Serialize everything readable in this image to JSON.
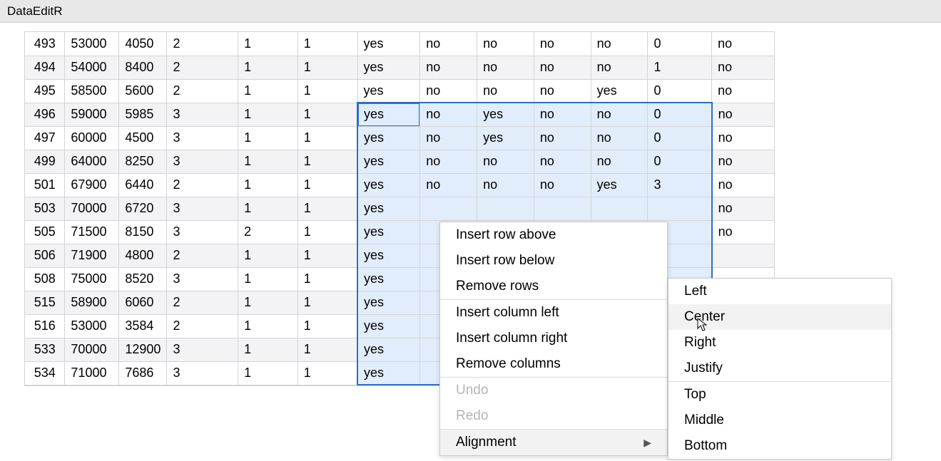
{
  "app": {
    "title": "DataEditR"
  },
  "rows": [
    {
      "idx": "493",
      "c": [
        "53000",
        "4050",
        "2",
        "1",
        "1",
        "yes",
        "no",
        "no",
        "no",
        "no",
        "0",
        "no"
      ]
    },
    {
      "idx": "494",
      "c": [
        "54000",
        "8400",
        "2",
        "1",
        "1",
        "yes",
        "no",
        "no",
        "no",
        "no",
        "1",
        "no"
      ]
    },
    {
      "idx": "495",
      "c": [
        "58500",
        "5600",
        "2",
        "1",
        "1",
        "yes",
        "no",
        "no",
        "no",
        "yes",
        "0",
        "no"
      ]
    },
    {
      "idx": "496",
      "c": [
        "59000",
        "5985",
        "3",
        "1",
        "1",
        "yes",
        "no",
        "yes",
        "no",
        "no",
        "0",
        "no"
      ]
    },
    {
      "idx": "497",
      "c": [
        "60000",
        "4500",
        "3",
        "1",
        "1",
        "yes",
        "no",
        "yes",
        "no",
        "no",
        "0",
        "no"
      ]
    },
    {
      "idx": "499",
      "c": [
        "64000",
        "8250",
        "3",
        "1",
        "1",
        "yes",
        "no",
        "no",
        "no",
        "no",
        "0",
        "no"
      ]
    },
    {
      "idx": "501",
      "c": [
        "67900",
        "6440",
        "2",
        "1",
        "1",
        "yes",
        "no",
        "no",
        "no",
        "yes",
        "3",
        "no"
      ]
    },
    {
      "idx": "503",
      "c": [
        "70000",
        "6720",
        "3",
        "1",
        "1",
        "yes",
        "",
        "",
        "",
        "",
        "",
        "no"
      ]
    },
    {
      "idx": "505",
      "c": [
        "71500",
        "8150",
        "3",
        "2",
        "1",
        "yes",
        "",
        "",
        "",
        "",
        "",
        "no"
      ]
    },
    {
      "idx": "506",
      "c": [
        "71900",
        "4800",
        "2",
        "1",
        "1",
        "yes",
        "",
        "",
        "",
        "",
        "",
        ""
      ]
    },
    {
      "idx": "508",
      "c": [
        "75000",
        "8520",
        "3",
        "1",
        "1",
        "yes",
        "",
        "",
        "",
        "",
        "",
        ""
      ]
    },
    {
      "idx": "515",
      "c": [
        "58900",
        "6060",
        "2",
        "1",
        "1",
        "yes",
        "",
        "",
        "",
        "",
        "",
        ""
      ]
    },
    {
      "idx": "516",
      "c": [
        "53000",
        "3584",
        "2",
        "1",
        "1",
        "yes",
        "",
        "",
        "",
        "",
        "",
        ""
      ]
    },
    {
      "idx": "533",
      "c": [
        "70000",
        "12900",
        "3",
        "1",
        "1",
        "yes",
        "",
        "",
        "",
        "",
        "",
        ""
      ]
    },
    {
      "idx": "534",
      "c": [
        "71000",
        "7686",
        "3",
        "1",
        "1",
        "yes",
        "",
        "",
        "",
        "",
        "",
        ""
      ]
    }
  ],
  "contextMenu": {
    "items": [
      {
        "label": "Insert row above",
        "type": "item"
      },
      {
        "label": "Insert row below",
        "type": "item"
      },
      {
        "label": "Remove rows",
        "type": "item"
      },
      {
        "type": "sep"
      },
      {
        "label": "Insert column left",
        "type": "item"
      },
      {
        "label": "Insert column right",
        "type": "item"
      },
      {
        "label": "Remove columns",
        "type": "item"
      },
      {
        "type": "sep"
      },
      {
        "label": "Undo",
        "type": "item",
        "disabled": true
      },
      {
        "label": "Redo",
        "type": "item",
        "disabled": true
      },
      {
        "type": "sep"
      },
      {
        "label": "Alignment",
        "type": "submenu",
        "hover": true
      }
    ],
    "submenu": [
      {
        "label": "Left"
      },
      {
        "label": "Center",
        "hover": true
      },
      {
        "label": "Right"
      },
      {
        "label": "Justify"
      },
      {
        "type": "sep"
      },
      {
        "label": "Top"
      },
      {
        "label": "Middle"
      },
      {
        "label": "Bottom"
      }
    ]
  },
  "selection": {
    "startRow": 3,
    "endRow": 14,
    "startCol": 5,
    "endCol": 10
  }
}
